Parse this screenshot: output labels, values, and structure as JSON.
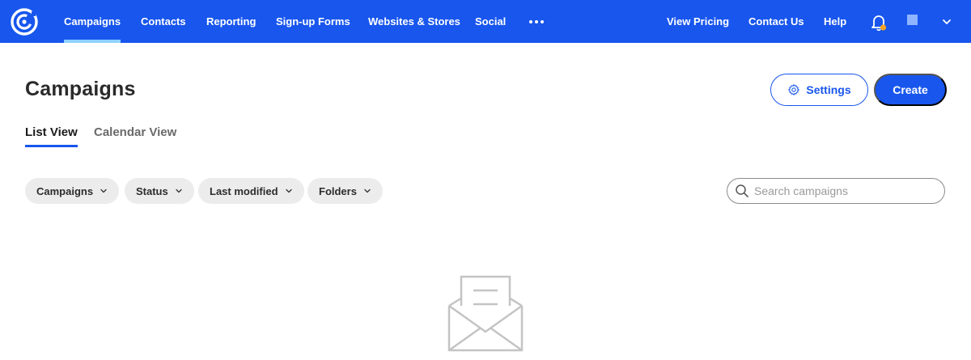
{
  "nav": {
    "items": [
      {
        "label": "Campaigns",
        "active": true
      },
      {
        "label": "Contacts"
      },
      {
        "label": "Reporting"
      },
      {
        "label": "Sign-up Forms"
      },
      {
        "label": "Websites & Stores"
      },
      {
        "label": "Social"
      }
    ],
    "right": [
      {
        "label": "View Pricing"
      },
      {
        "label": "Contact Us"
      },
      {
        "label": "Help"
      }
    ],
    "bar_color": "#1856ed",
    "active_underline_color": "#8fd2ff",
    "notification_dot_color": "#f5a623"
  },
  "page": {
    "title": "Campaigns"
  },
  "actions": {
    "settings_label": "Settings",
    "create_label": "Create"
  },
  "tabs": [
    {
      "label": "List View",
      "active": true
    },
    {
      "label": "Calendar View"
    }
  ],
  "filters": [
    {
      "label": "Campaigns"
    },
    {
      "label": "Status"
    },
    {
      "label": "Last modified"
    },
    {
      "label": "Folders"
    }
  ],
  "search": {
    "placeholder": "Search campaigns"
  },
  "icons": {
    "logo": "constant-contact-logo-icon",
    "more": "more-horizontal-icon",
    "bell": "bell-icon",
    "account": "account-icon",
    "account_menu": "chevron-down-icon",
    "settings": "gear-icon",
    "filter_caret": "chevron-down-icon",
    "search": "search-icon",
    "empty_state": "envelope-letter-icon"
  }
}
